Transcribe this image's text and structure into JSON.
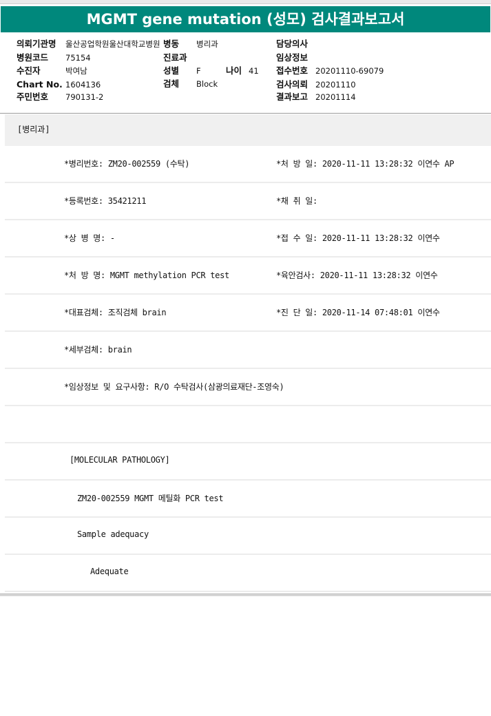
{
  "title": "MGMT gene mutation (성모) 검사결과보고서",
  "header": {
    "col1": [
      {
        "label": "의뢰기관명",
        "value": "울산공업학원울산대학교병원"
      },
      {
        "label": "병원코드",
        "value": "75154"
      },
      {
        "label": "수진자",
        "value": "박여남"
      },
      {
        "label": "Chart No.",
        "value": "1604136"
      },
      {
        "label": "주민번호",
        "value": "790131-2"
      }
    ],
    "col2": [
      {
        "label": "병동",
        "value": "병리과"
      },
      {
        "label": "진료과",
        "value": ""
      },
      {
        "label": "성별",
        "value": "F"
      },
      {
        "label": "검체",
        "value": "Block"
      }
    ],
    "age": {
      "label": "나이",
      "value": "41"
    },
    "col3": [
      {
        "label": "담당의사",
        "value": ""
      },
      {
        "label": "임상정보",
        "value": ""
      },
      {
        "label": "접수번호",
        "value": "20201110-69079"
      },
      {
        "label": "검사의뢰",
        "value": "20201110"
      },
      {
        "label": "결과보고",
        "value": "20201114"
      }
    ]
  },
  "department": "[병리과]",
  "rows": [
    {
      "left": "*병리번호: ZM20-002559 (수탁)",
      "right": "*처 방 일: 2020-11-11 13:28:32  이연수 AP"
    },
    {
      "left": "*등록번호: 35421211",
      "right": "*채 취 일:"
    },
    {
      "left": "*상 병 명: -",
      "right": "*접 수 일: 2020-11-11 13:28:32  이연수"
    },
    {
      "left": "*처 방 명: MGMT methylation  PCR test",
      "right": "*육안검사: 2020-11-11 13:28:32  이연수"
    },
    {
      "left": "*대표검체: 조직검체 brain",
      "right": "*진 단 일: 2020-11-14 07:48:01  이연수"
    },
    {
      "left": "*세부검체: brain",
      "right": ""
    },
    {
      "left": "*임상정보 및 요구사항: R/O 수탁검사(삼광의료재단-조영숙)",
      "right": ""
    },
    {
      "left": "",
      "right": ""
    }
  ],
  "report": {
    "section": "[MOLECULAR PATHOLOGY]",
    "line1": "ZM20-002559    MGMT 메틸화  PCR test",
    "line2": "Sample adequacy",
    "line3": "Adequate"
  }
}
